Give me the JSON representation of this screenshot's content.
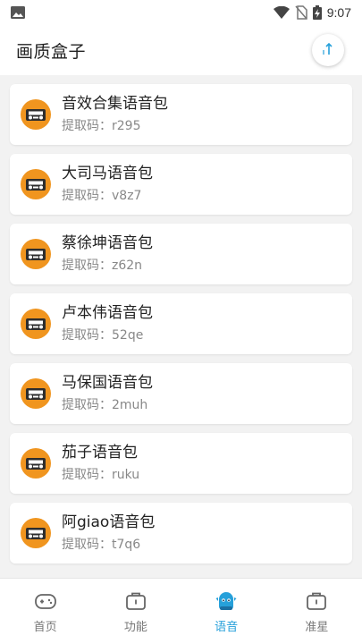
{
  "status_bar": {
    "time": "9:07",
    "icons": [
      "image-icon",
      "wifi-icon",
      "no-sim-icon",
      "battery-charging-icon"
    ]
  },
  "app_bar": {
    "title": "画质盒子",
    "action_icon": "upload-icon"
  },
  "voice_packs": [
    {
      "title": "音效合集语音包",
      "code": "提取码：r295"
    },
    {
      "title": "大司马语音包",
      "code": "提取码：v8z7"
    },
    {
      "title": "蔡徐坤语音包",
      "code": "提取码：z62n"
    },
    {
      "title": "卢本伟语音包",
      "code": "提取码：52qe"
    },
    {
      "title": "马保国语音包",
      "code": "提取码：2muh"
    },
    {
      "title": "茄子语音包",
      "code": "提取码：ruku"
    },
    {
      "title": "阿giao语音包",
      "code": "提取码：t7q6"
    }
  ],
  "tabs": [
    {
      "label": "首页",
      "icon": "gamepad-icon"
    },
    {
      "label": "功能",
      "icon": "toolbox-icon"
    },
    {
      "label": "语音",
      "icon": "voice-mascot-icon"
    },
    {
      "label": "准星",
      "icon": "toolbox-icon"
    }
  ],
  "colors": {
    "accent": "#26a0da",
    "icon_orange": "#f0951f",
    "icon_dark": "#2d2d2d"
  },
  "active_tab": "语音"
}
